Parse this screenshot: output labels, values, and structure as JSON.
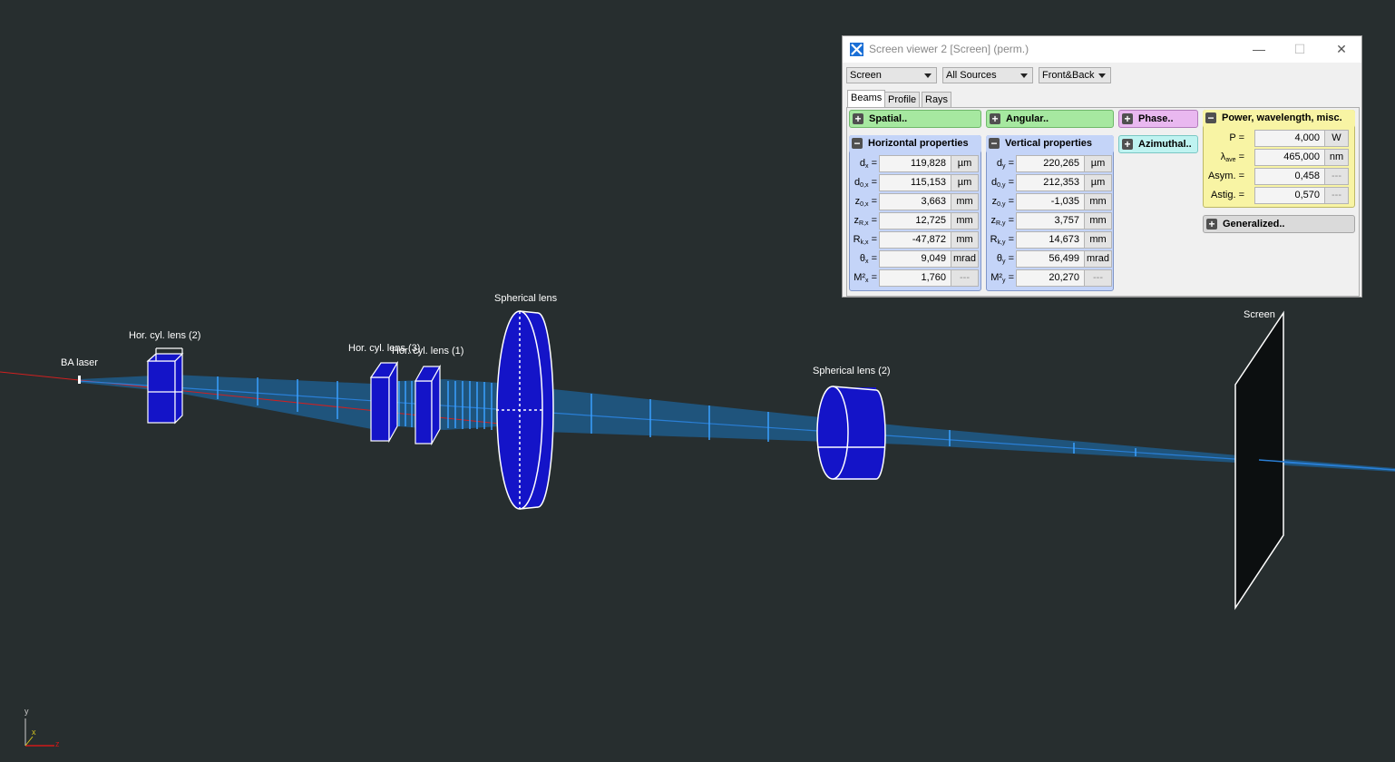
{
  "scene": {
    "labels": {
      "ba_laser": "BA laser",
      "hor_cyl_lens_2": "Hor. cyl. lens (2)",
      "hor_cyl_lens_3": "Hor. cyl. lens (3)",
      "hor_cyl_lens_1": "Hor. cyl. lens (1)",
      "spherical_lens": "Spherical lens",
      "spherical_lens_2": "Spherical lens (2)",
      "screen": "Screen"
    },
    "axes": {
      "y": "y",
      "x": "x",
      "z": "z"
    },
    "colors": {
      "background": "#272e2f",
      "optic_fill": "#1414c8",
      "beam": "#2a7fd6",
      "ray": "#d02020"
    }
  },
  "window": {
    "title": "Screen viewer 2 [Screen] (perm.)",
    "controls": {
      "minimize": "—",
      "maximize": "☐",
      "close": "✕"
    },
    "combos": {
      "screen": "Screen",
      "sources": "All Sources",
      "sides": "Front&Back"
    },
    "tabs": [
      "Beams",
      "Profile",
      "Rays"
    ],
    "active_tab": "Beams",
    "sections": {
      "spatial": "Spatial..",
      "angular": "Angular..",
      "phase": "Phase..",
      "azimuthal": "Azimuthal..",
      "power": "Power, wavelength, misc.",
      "generalized": "Generalized..",
      "horizontal": "Horizontal properties",
      "vertical": "Vertical properties"
    },
    "horizontal": [
      {
        "name": "d",
        "sub": "x",
        "value": "119,828",
        "unit": "µm"
      },
      {
        "name": "d",
        "sub": "0,x",
        "value": "115,153",
        "unit": "µm"
      },
      {
        "name": "z",
        "sub": "0,x",
        "value": "3,663",
        "unit": "mm"
      },
      {
        "name": "z",
        "sub": "R,x",
        "value": "12,725",
        "unit": "mm"
      },
      {
        "name": "R",
        "sub": "k,x",
        "value": "-47,872",
        "unit": "mm"
      },
      {
        "name": "θ",
        "sub": "x",
        "value": "9,049",
        "unit": "mrad"
      },
      {
        "name": "M²",
        "sub": "x",
        "value": "1,760",
        "unit": "---"
      }
    ],
    "vertical": [
      {
        "name": "d",
        "sub": "y",
        "value": "220,265",
        "unit": "µm"
      },
      {
        "name": "d",
        "sub": "0,y",
        "value": "212,353",
        "unit": "µm"
      },
      {
        "name": "z",
        "sub": "0,y",
        "value": "-1,035",
        "unit": "mm"
      },
      {
        "name": "z",
        "sub": "R,y",
        "value": "3,757",
        "unit": "mm"
      },
      {
        "name": "R",
        "sub": "k,y",
        "value": "14,673",
        "unit": "mm"
      },
      {
        "name": "θ",
        "sub": "y",
        "value": "56,499",
        "unit": "mrad"
      },
      {
        "name": "M²",
        "sub": "y",
        "value": "20,270",
        "unit": "---"
      }
    ],
    "power": [
      {
        "name": "P",
        "sub": "",
        "value": "4,000",
        "unit": "W"
      },
      {
        "name": "λ",
        "sub": "ave",
        "value": "465,000",
        "unit": "nm"
      },
      {
        "name": "Asym.",
        "sub": "",
        "value": "0,458",
        "unit": "---"
      },
      {
        "name": "Astig.",
        "sub": "",
        "value": "0,570",
        "unit": "---"
      }
    ]
  }
}
